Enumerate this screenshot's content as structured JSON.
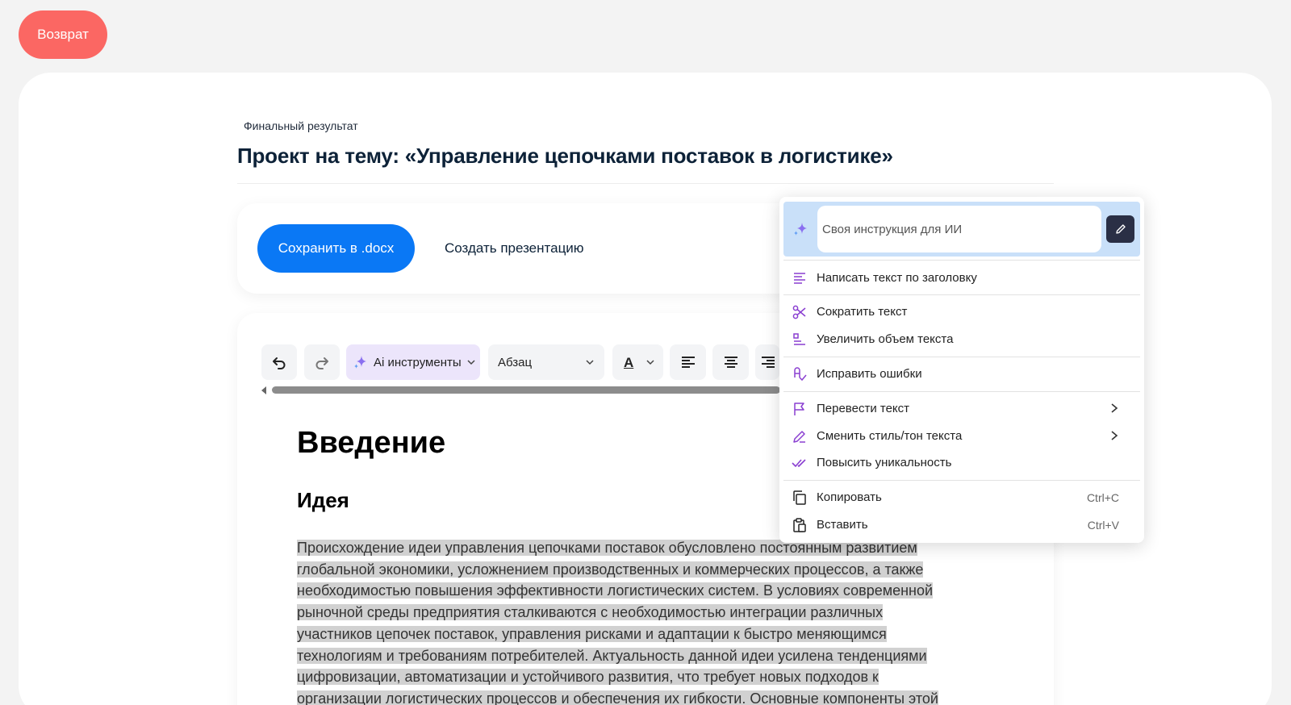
{
  "back_button": "Возврат",
  "header": {
    "kicker": "Финальный результат",
    "title": "Проект на тему: «Управление цепочками поставок в логистике»"
  },
  "actions": {
    "save": "Сохранить в .docx",
    "presentation": "Создать презентацию"
  },
  "toolbar": {
    "ai_tools": "Ai инструменты",
    "paragraph": "Абзац",
    "color_letter": "A"
  },
  "document": {
    "heading1": "Введение",
    "heading2": "Идея",
    "lines": [
      "Происхождение идеи управления цепочками поставок обусловлено постоянным развитием",
      "глобальной экономики, усложнением производственных и коммерческих процессов, а также",
      "необходимостью повышения эффективности логистических систем. В условиях современной",
      "рыночной среды предприятия сталкиваются с необходимостью интеграции различных",
      "участников цепочек поставок, управления рисками и адаптации к быстро меняющимся",
      "технологиям и требованиям потребителей. Актуальность данной идеи усилена тенденциями",
      "цифровизации, автоматизации и устойчивого развития, что требует новых подходов к",
      "организации логистических процессов и обеспечения их гибкости. Основные компоненты этой"
    ]
  },
  "ai_menu": {
    "input_placeholder": "Своя инструкция для ИИ",
    "items": [
      {
        "label": "Написать текст по заголовку",
        "icon": "align-lines-icon"
      },
      {
        "label": "Сократить текст",
        "icon": "scissors-icon"
      },
      {
        "label": "Увеличить объем текста",
        "icon": "expand-text-icon"
      },
      {
        "label": "Исправить ошибки",
        "icon": "spellcheck-icon"
      },
      {
        "label": "Перевести текст",
        "icon": "translate-flag-icon"
      },
      {
        "label": "Сменить стиль/тон текста",
        "icon": "pencil-icon"
      },
      {
        "label": "Повысить уникальность",
        "icon": "double-check-icon"
      },
      {
        "label": "Копировать",
        "icon": "copy-icon",
        "shortcut": "Ctrl+C"
      },
      {
        "label": "Вставить",
        "icon": "paste-icon",
        "shortcut": "Ctrl+V"
      }
    ]
  },
  "colors": {
    "back": "#fb6763",
    "primary": "#0a78f5",
    "ai_accent": "#8a3fd1",
    "menu_head": "#c9e0f9",
    "selection": "#d1d1d1"
  }
}
